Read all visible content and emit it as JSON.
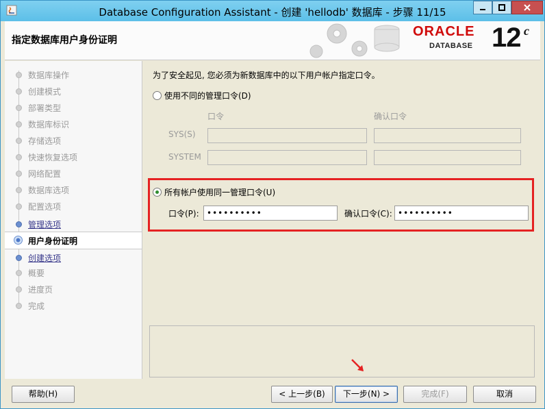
{
  "window": {
    "title": "Database Configuration Assistant - 创建 'hellodb' 数据库 - 步骤 11/15"
  },
  "header": {
    "title": "指定数据库用户身份证明",
    "logo_oracle": "ORACLE",
    "logo_database": "DATABASE",
    "logo_version": "12",
    "logo_version_suffix": "c"
  },
  "sidebar": {
    "steps": [
      {
        "label": "数据库操作",
        "state": "disabled"
      },
      {
        "label": "创建模式",
        "state": "disabled"
      },
      {
        "label": "部署类型",
        "state": "disabled"
      },
      {
        "label": "数据库标识",
        "state": "disabled"
      },
      {
        "label": "存储选项",
        "state": "disabled"
      },
      {
        "label": "快速恢复选项",
        "state": "disabled"
      },
      {
        "label": "网络配置",
        "state": "disabled"
      },
      {
        "label": "数据库选项",
        "state": "disabled"
      },
      {
        "label": "配置选项",
        "state": "disabled"
      },
      {
        "label": "管理选项",
        "state": "link"
      },
      {
        "label": "用户身份证明",
        "state": "current"
      },
      {
        "label": "创建选项",
        "state": "link"
      },
      {
        "label": "概要",
        "state": "disabled"
      },
      {
        "label": "进度页",
        "state": "disabled"
      },
      {
        "label": "完成",
        "state": "disabled"
      }
    ]
  },
  "main": {
    "intro": "为了安全起见, 您必须为新数据库中的以下用户帐户指定口令。",
    "option_different": {
      "label": "使用不同的管理口令(D)",
      "selected": false,
      "col_password": "口令",
      "col_confirm": "确认口令",
      "rows": [
        {
          "label": "SYS(S)"
        },
        {
          "label": "SYSTEM"
        }
      ]
    },
    "option_same": {
      "label": "所有帐户使用同一管理口令(U)",
      "selected": true,
      "password_label": "口令(P):",
      "password_value": "••••••••••",
      "confirm_label": "确认口令(C):",
      "confirm_value": "••••••••••"
    }
  },
  "buttons": {
    "help": "帮助(H)",
    "back": "< 上一步(B)",
    "next": "下一步(N) >",
    "finish": "完成(F)",
    "cancel": "取消"
  },
  "colors": {
    "highlight": "#e52222",
    "oracle_red": "#d00a0a",
    "titlebar": "#5cbfe8"
  }
}
